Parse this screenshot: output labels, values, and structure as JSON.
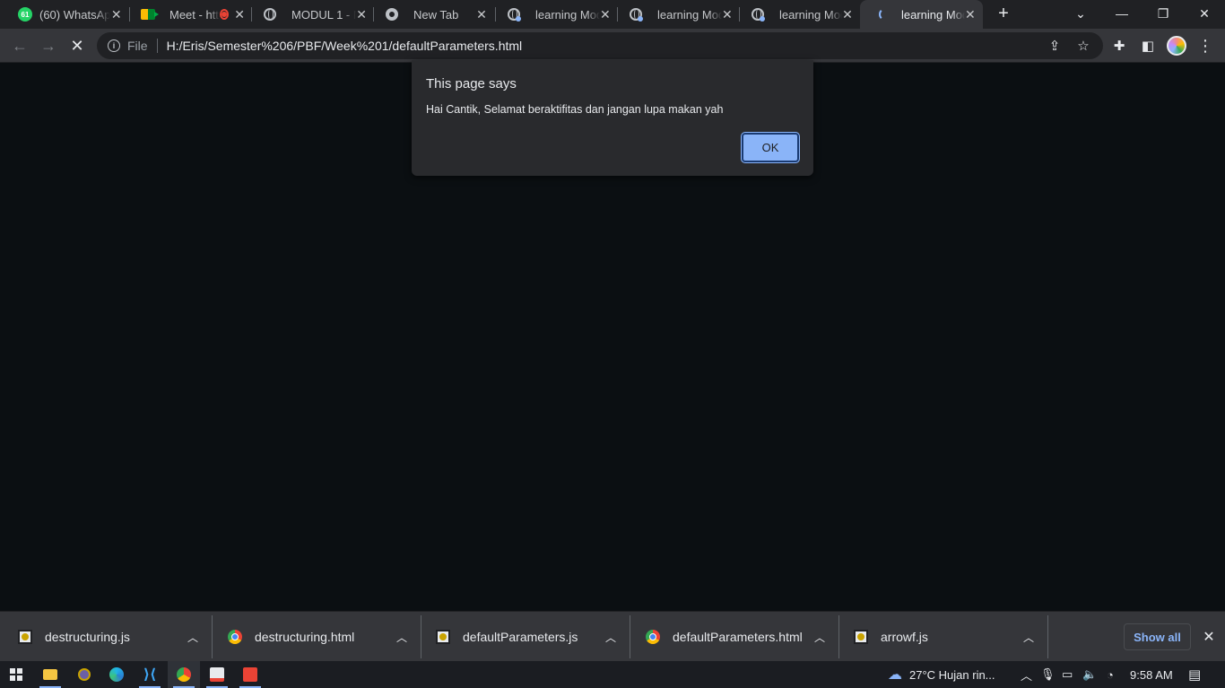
{
  "tabs": [
    {
      "title": "(60) WhatsApp",
      "icon": "whatsapp-icon",
      "badge": "61"
    },
    {
      "title": "Meet - https://meet.google.com",
      "icon": "google-meet-icon"
    },
    {
      "title": "MODUL 1 - Modul",
      "icon": "globe-icon"
    },
    {
      "title": "New Tab",
      "icon": "chrome-icon"
    },
    {
      "title": "learning Module",
      "icon": "globe-icon"
    },
    {
      "title": "learning Module",
      "icon": "globe-icon"
    },
    {
      "title": "learning Module",
      "icon": "globe-icon"
    },
    {
      "title": "learning Module",
      "icon": "loading-spinner-icon"
    }
  ],
  "toolbar": {
    "scheme": "File",
    "url": "H:/Eris/Semester%206/PBF/Week%201/defaultParameters.html"
  },
  "dialog": {
    "title": "This page says",
    "message": "Hai Cantik, Selamat beraktifitas dan jangan lupa makan yah",
    "ok_label": "OK"
  },
  "downloads": [
    {
      "name": "destructuring.js",
      "icon": "js-file-icon"
    },
    {
      "name": "destructuring.html",
      "icon": "chrome-file-icon"
    },
    {
      "name": "defaultParameters.js",
      "icon": "js-file-icon"
    },
    {
      "name": "defaultParameters.html",
      "icon": "chrome-file-icon"
    },
    {
      "name": "arrowf.js",
      "icon": "js-file-icon"
    }
  ],
  "shelf": {
    "show_all_label": "Show all"
  },
  "taskbar": {
    "weather": "27°C  Hujan rin...",
    "time": "9:58 AM"
  },
  "colors": {
    "accent": "#8ab4f8",
    "page_bg": "#0b0f12",
    "tabstrip_bg": "#202124",
    "toolbar_bg": "#35363a"
  }
}
